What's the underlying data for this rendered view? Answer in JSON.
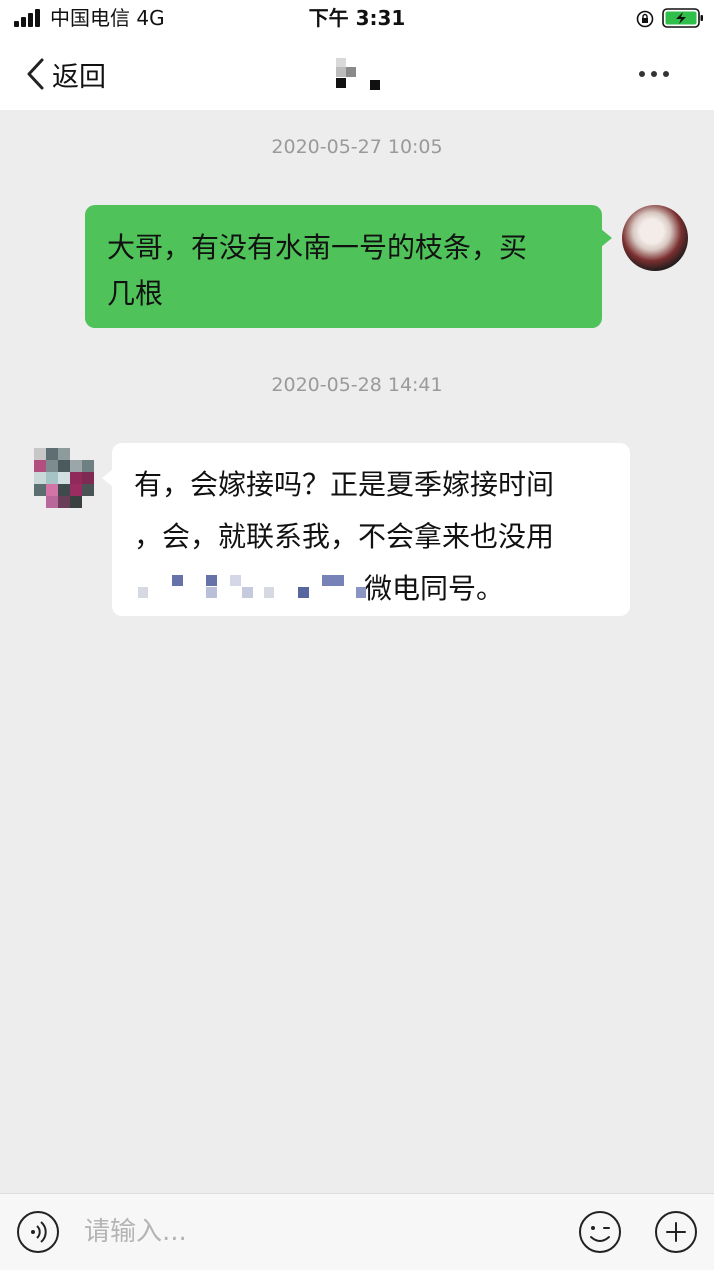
{
  "status_bar": {
    "carrier": "中国电信  4G",
    "time": "下午 3:31",
    "icons": [
      "signal-icon",
      "rotation-lock-icon",
      "battery-charging-icon"
    ],
    "battery_color": "#2fbf4a"
  },
  "nav": {
    "back_label": "返回",
    "more_icon": "more-icon"
  },
  "messages": [
    {
      "timestamp": "2020-05-27 10:05",
      "direction": "outgoing",
      "lines": [
        "大哥，有没有水南一号的枝条，买",
        "几根"
      ]
    },
    {
      "timestamp": "2020-05-28 14:41",
      "direction": "incoming",
      "lines": [
        "有，会嫁接吗？正是夏季嫁接时间",
        "，会，就联系我，不会拿来也没用",
        "微电同号。"
      ]
    }
  ],
  "input": {
    "placeholder": "请输入..."
  },
  "colors": {
    "outgoing_bubble": "#4fc259",
    "incoming_bubble": "#ffffff",
    "background": "#ededed",
    "timestamp": "#9a9a9a"
  }
}
